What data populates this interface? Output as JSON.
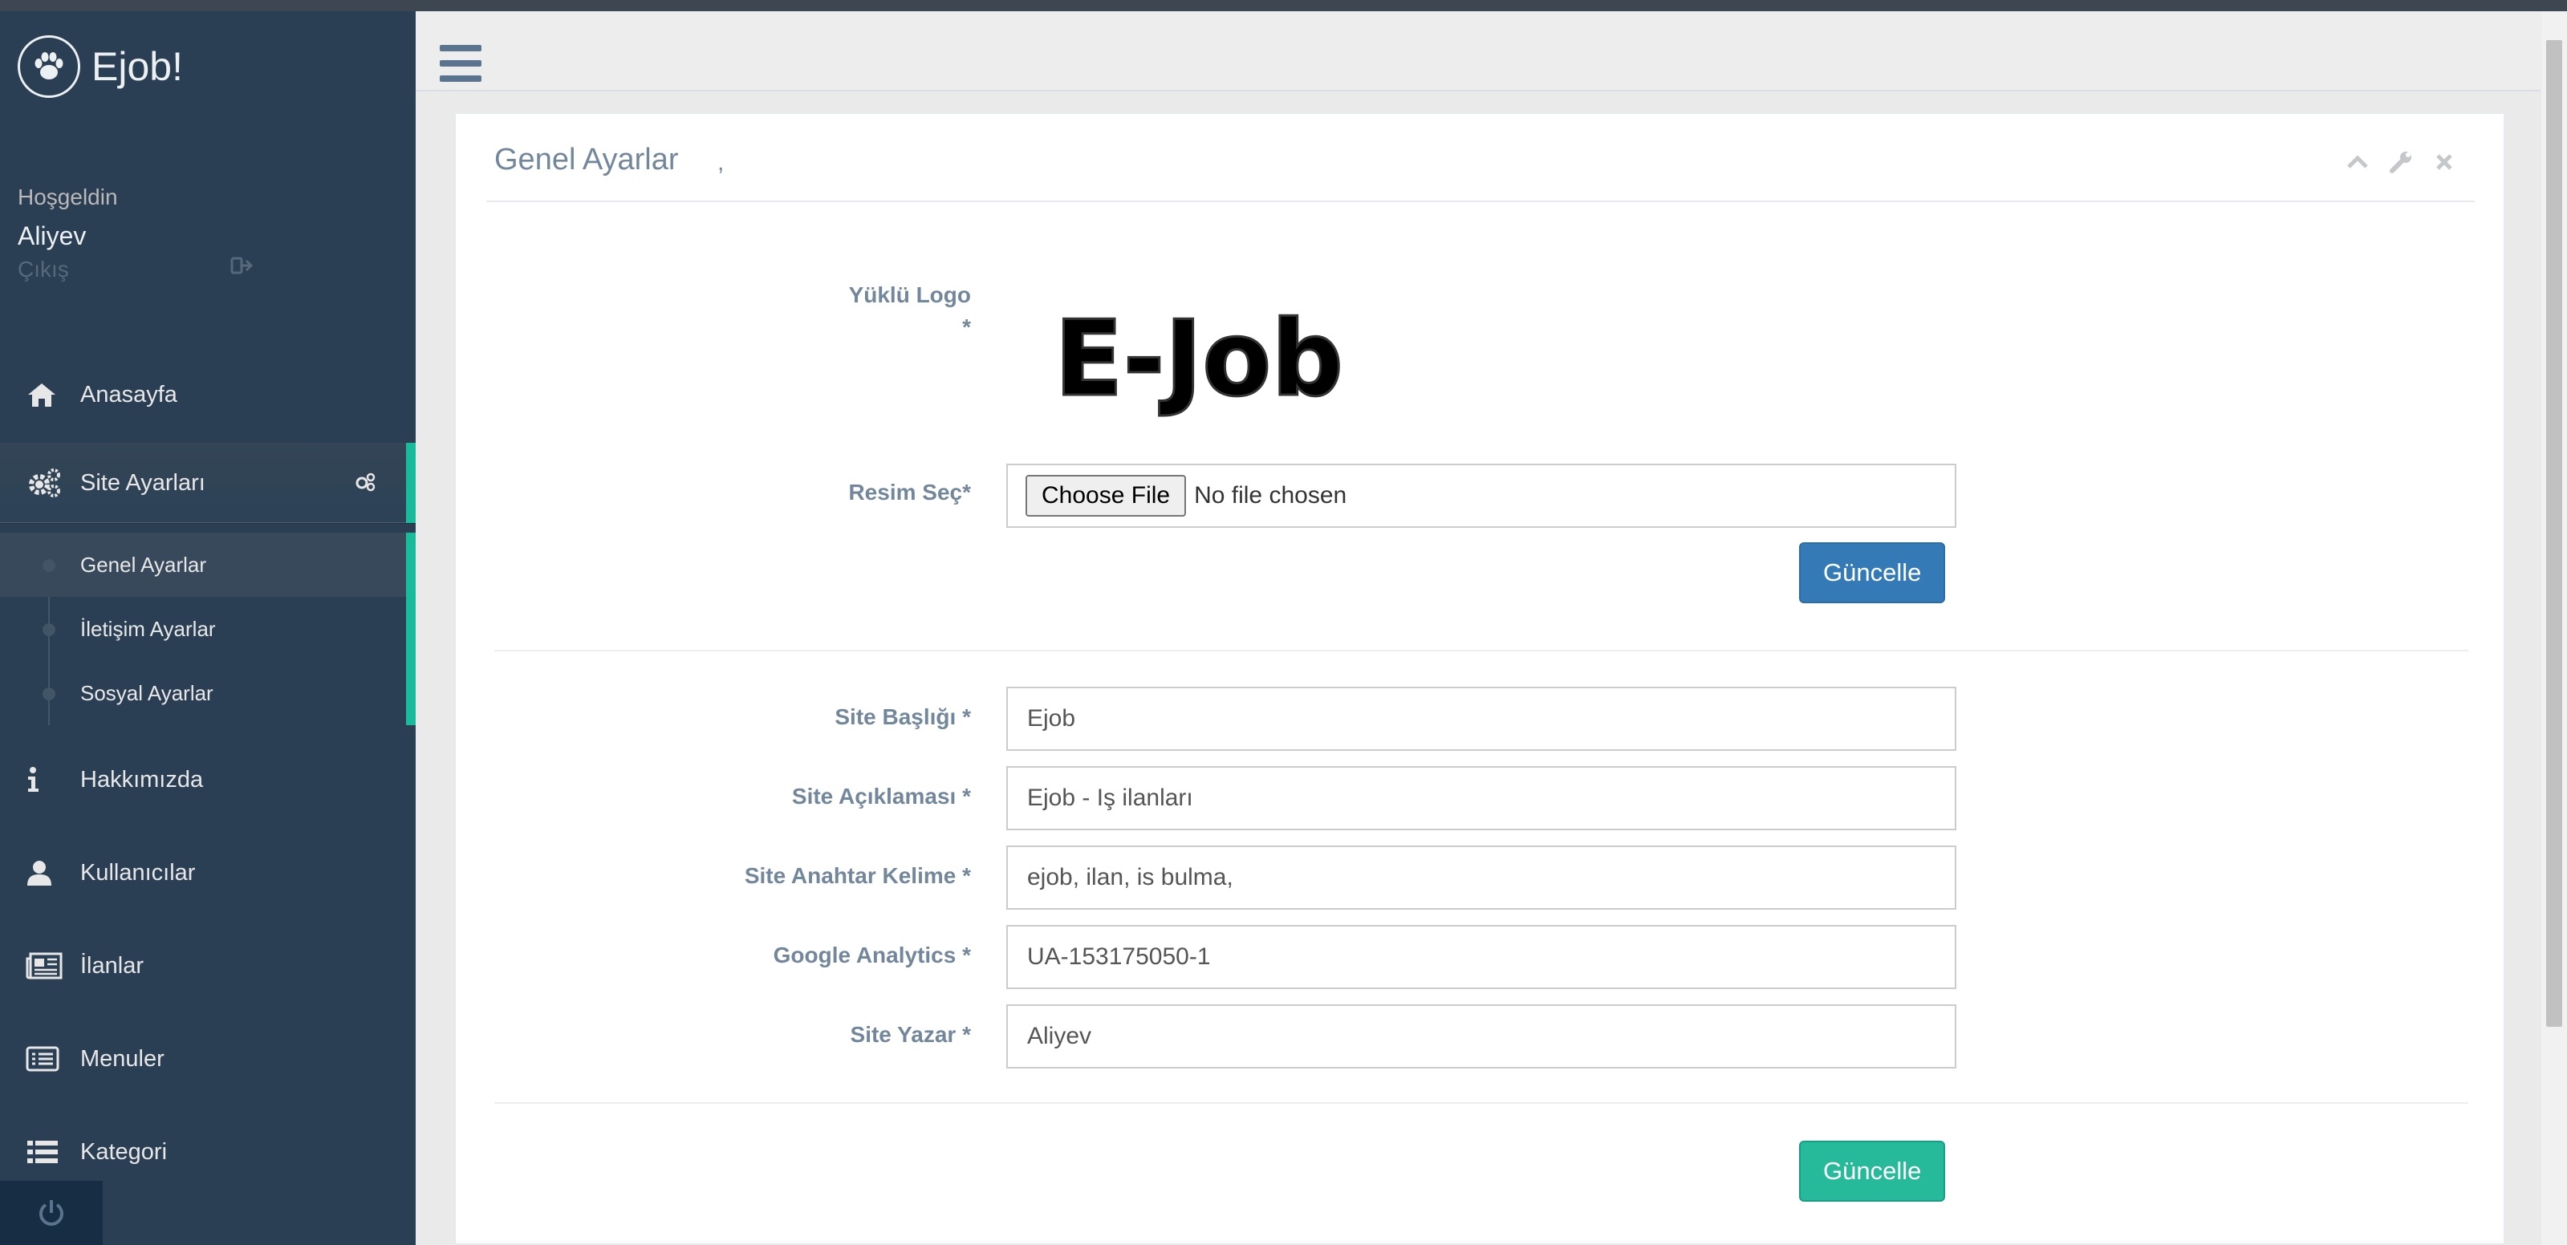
{
  "brand": {
    "title": "Ejob!"
  },
  "profile": {
    "welcome": "Hoşgeldin",
    "name": "Aliyev",
    "logout": "Çıkış"
  },
  "nav": {
    "home": "Anasayfa",
    "site_settings": "Site Ayarları",
    "sub": {
      "general": "Genel Ayarlar",
      "contact": "İletişim Ayarlar",
      "social": "Sosyal Ayarlar"
    },
    "about": "Hakkımızda",
    "users": "Kullanıcılar",
    "listings": "İlanlar",
    "menus": "Menuler",
    "category": "Kategori"
  },
  "panel": {
    "title": "Genel Ayarlar",
    "comma": ","
  },
  "logo_form": {
    "uploaded_logo_label": "Yüklü Logo",
    "required_mark": "*",
    "logo_text": "E-Job",
    "choose_image_label": "Resim Seç*",
    "file_button": "Choose File",
    "file_status": "No file chosen",
    "submit": "Güncelle"
  },
  "settings_form": {
    "site_title_label": "Site Başlığı *",
    "site_title_value": "Ejob",
    "site_desc_label": "Site Açıklaması *",
    "site_desc_value": "Ejob - Iş ilanları",
    "keywords_label": "Site Anahtar Kelime *",
    "keywords_value": "ejob, ilan, is bulma,",
    "analytics_label": "Google Analytics *",
    "analytics_value": "UA-153175050-1",
    "author_label": "Site Yazar *",
    "author_value": "Aliyev",
    "submit": "Güncelle"
  },
  "colors": {
    "sidebar": "#2a3f54",
    "accent": "#1abb9c",
    "primary_button": "#337ab7",
    "success_button": "#26b99a",
    "label": "#73879c"
  }
}
